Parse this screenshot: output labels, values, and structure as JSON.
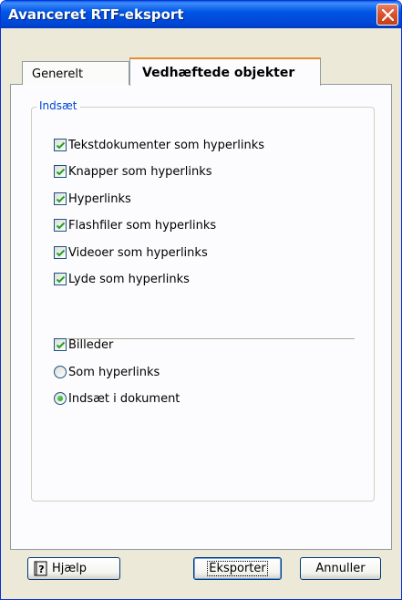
{
  "window": {
    "title": "Avanceret RTF-eksport"
  },
  "tabs": [
    {
      "label": "Generelt",
      "active": false
    },
    {
      "label": "Vedhæftede objekter",
      "active": true
    }
  ],
  "group": {
    "label": "Indsæt"
  },
  "options": [
    {
      "label": "Tekstdokumenter som hyperlinks",
      "checked": true
    },
    {
      "label": "Knapper som hyperlinks",
      "checked": true
    },
    {
      "label": "Hyperlinks",
      "checked": true
    },
    {
      "label": "Flashfiler som hyperlinks",
      "checked": true
    },
    {
      "label": "Videoer som hyperlinks",
      "checked": true
    },
    {
      "label": "Lyde som hyperlinks",
      "checked": true
    }
  ],
  "images": {
    "label": "Billeder",
    "checked": true,
    "radios": [
      {
        "label": "Som hyperlinks",
        "selected": false
      },
      {
        "label": "Indsæt i dokument",
        "selected": true
      }
    ]
  },
  "buttons": {
    "help": "Hjælp",
    "export": "Eksporter",
    "cancel": "Annuller"
  }
}
